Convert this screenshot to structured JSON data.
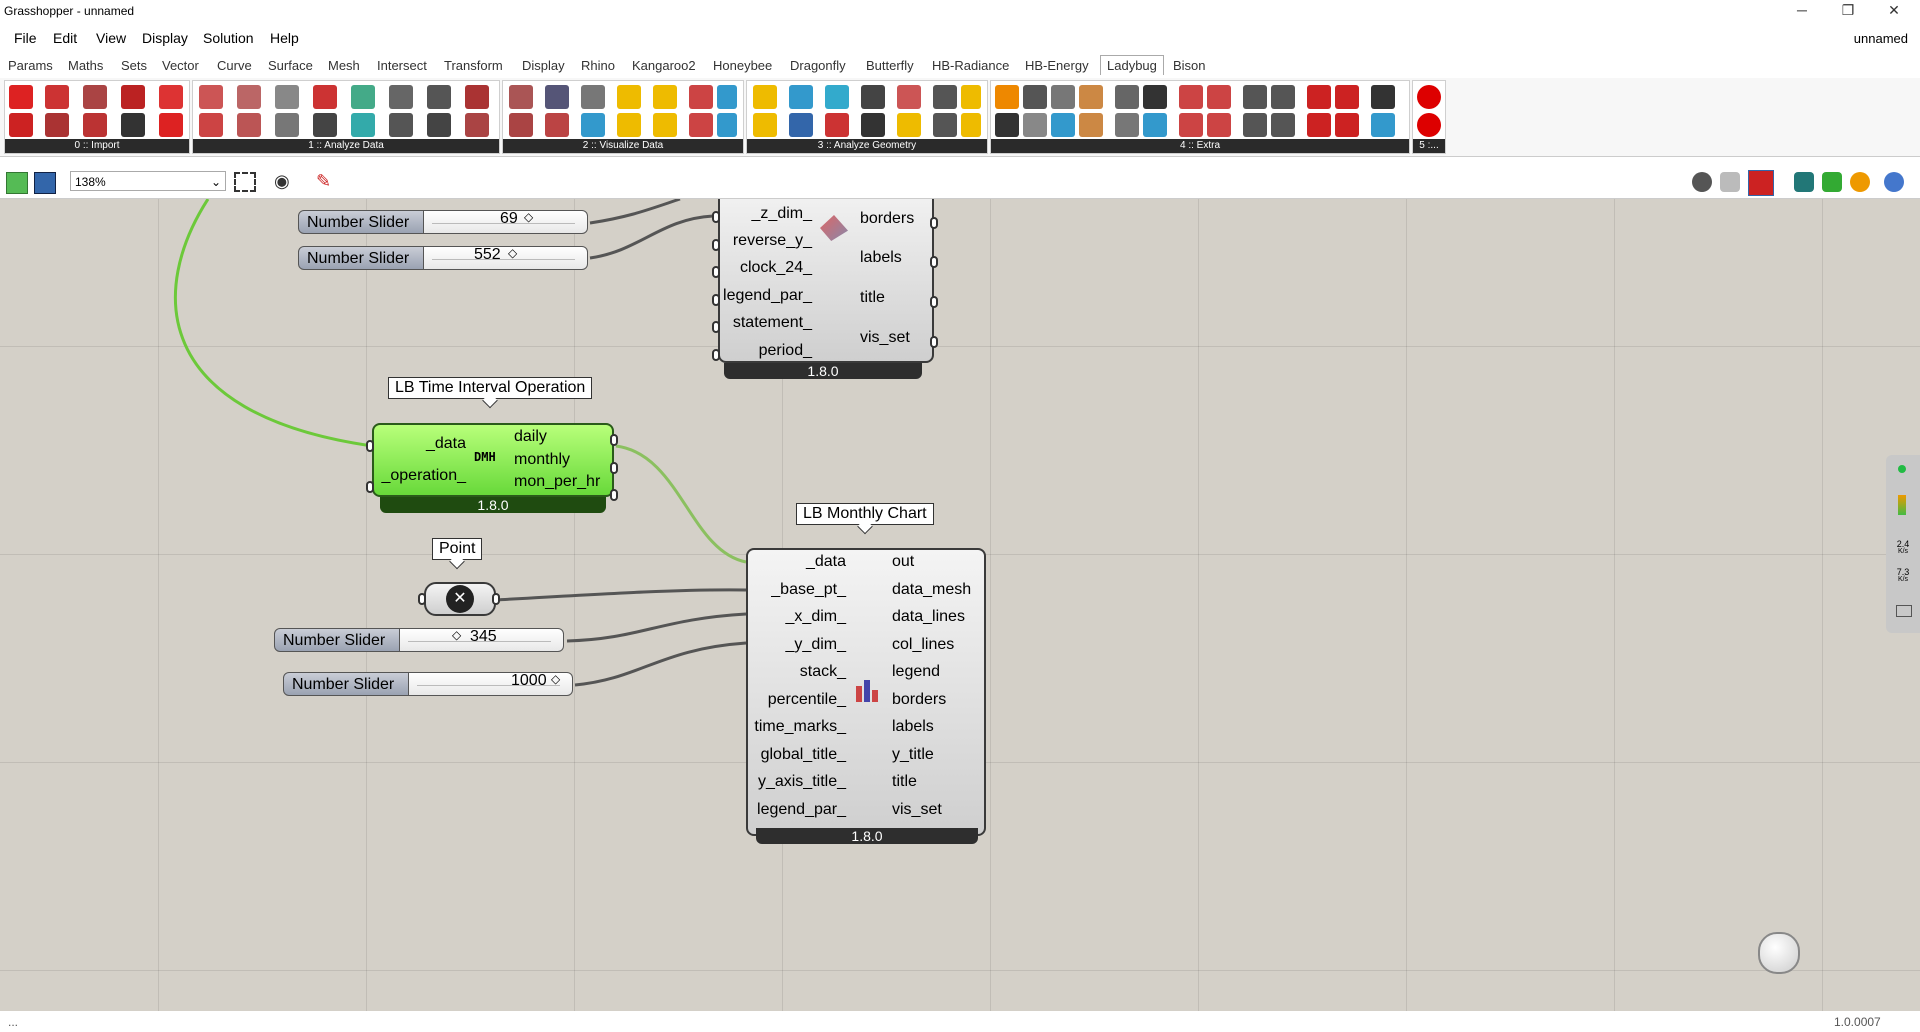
{
  "window": {
    "title": "Grasshopper - unnamed",
    "doc_name": "unnamed"
  },
  "menu": [
    "File",
    "Edit",
    "View",
    "Display",
    "Solution",
    "Help"
  ],
  "tabs": [
    "Params",
    "Maths",
    "Sets",
    "Vector",
    "Curve",
    "Surface",
    "Mesh",
    "Intersect",
    "Transform",
    "Display",
    "Rhino",
    "Kangaroo2",
    "Honeybee",
    "Dragonfly",
    "Butterfly",
    "HB-Radiance",
    "HB-Energy",
    "Ladybug",
    "Bison"
  ],
  "active_tab": "Ladybug",
  "ribbon_groups": [
    "0 :: Import",
    "1 :: Analyze Data",
    "2 :: Visualize Data",
    "3 :: Analyze Geometry",
    "4 :: Extra",
    "5 :..."
  ],
  "zoom": "138%",
  "components": {
    "top_partial": {
      "inputs": [
        "_z_dim_",
        "reverse_y_",
        "clock_24_",
        "legend_par_",
        "statement_",
        "period_"
      ],
      "outputs": [
        "borders",
        "labels",
        "title",
        "vis_set"
      ],
      "version": "1.8.0"
    },
    "time_interval": {
      "name": "LB Time Interval Operation",
      "inputs": [
        "_data",
        "_operation_"
      ],
      "outputs": [
        "daily",
        "monthly",
        "mon_per_hr"
      ],
      "icon_text": "DMH",
      "version": "1.8.0"
    },
    "monthly_chart": {
      "name": "LB Monthly Chart",
      "inputs": [
        "_data",
        "_base_pt_",
        "_x_dim_",
        "_y_dim_",
        "stack_",
        "percentile_",
        "time_marks_",
        "global_title_",
        "y_axis_title_",
        "legend_par_"
      ],
      "outputs": [
        "out",
        "data_mesh",
        "data_lines",
        "col_lines",
        "legend",
        "borders",
        "labels",
        "y_title",
        "title",
        "vis_set"
      ],
      "version": "1.8.0"
    },
    "point": {
      "name": "Point"
    }
  },
  "sliders": [
    {
      "label": "Number Slider",
      "value": "69"
    },
    {
      "label": "Number Slider",
      "value": "552"
    },
    {
      "label": "Number Slider",
      "value": "345"
    },
    {
      "label": "Number Slider",
      "value": "1000"
    }
  ],
  "side_panel": {
    "rate1": "2.4",
    "rate1_unit": "K/s",
    "rate2": "7.3",
    "rate2_unit": "K/s"
  },
  "status": {
    "left": "...",
    "version": "1.0.0007"
  }
}
